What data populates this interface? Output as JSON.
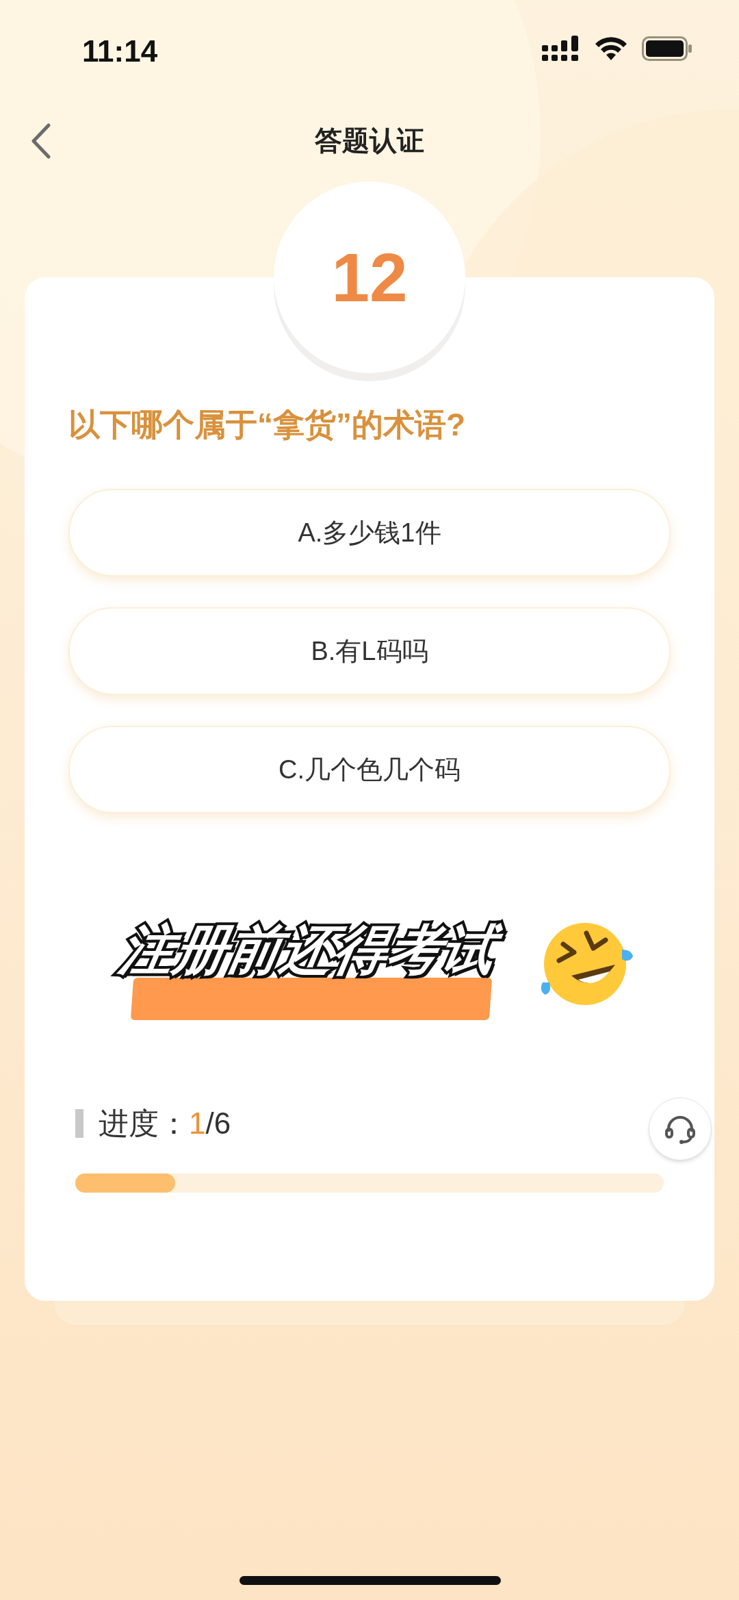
{
  "status_bar": {
    "time": "11:14"
  },
  "header": {
    "title": "答题认证"
  },
  "question": {
    "number": "12",
    "text": "以下哪个属于“拿货”的术语?"
  },
  "options": [
    {
      "label": "A.多少钱1件",
      "selected": false
    },
    {
      "label": "B.有L码吗",
      "selected": false
    },
    {
      "label": "C.几个色几个码",
      "selected": false
    }
  ],
  "caption": {
    "text": "注册前还得考试"
  },
  "progress": {
    "label": "进度：",
    "current": "1",
    "total": "/6",
    "level": 0.17
  }
}
